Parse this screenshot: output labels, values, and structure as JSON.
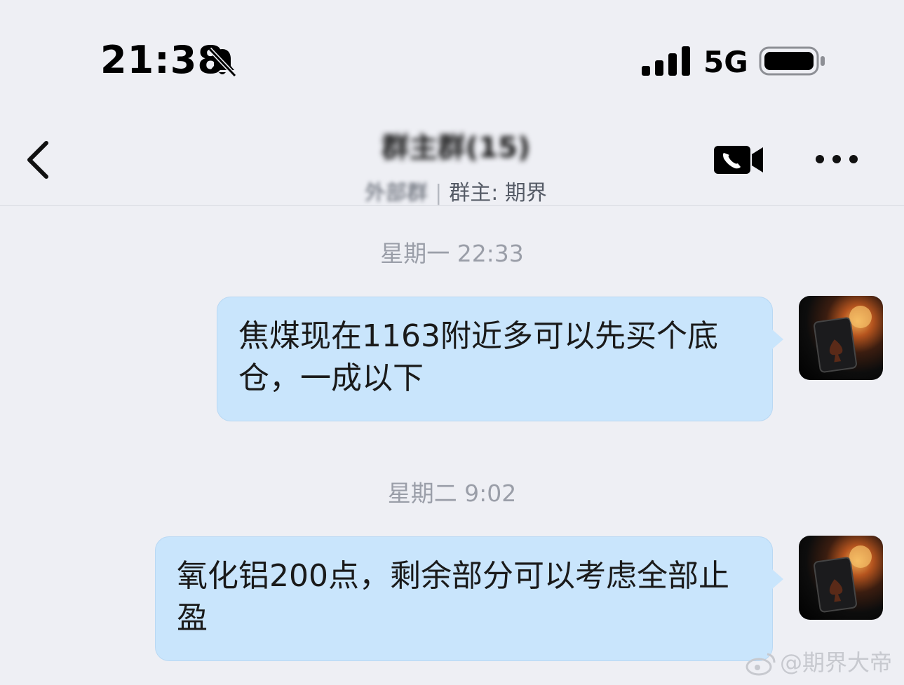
{
  "status_bar": {
    "time": "21:38",
    "network": "5G",
    "icons": [
      "bell-muted-icon",
      "signal-icon",
      "battery-icon"
    ]
  },
  "nav": {
    "title": "群主群(15)",
    "subtitle_left": "外部群",
    "subtitle_right": "群主: 期界",
    "icons": [
      "chevron-left-icon",
      "video-call-icon",
      "more-icon"
    ]
  },
  "chat": {
    "messages": [
      {
        "timestamp": "星期一 22:33",
        "text": "焦煤现在1163附近多可以先买个底仓，一成以下"
      },
      {
        "timestamp": "星期二 9:02",
        "text": "氧化铝200点，剩余部分可以考虑全部止盈"
      }
    ]
  },
  "watermark": {
    "text": "@期界大帝",
    "icon": "weibo-logo-icon"
  },
  "colors": {
    "bubble": "#c9e5fc",
    "background": "#eeeff4",
    "timestamp": "#9a9ea8"
  }
}
